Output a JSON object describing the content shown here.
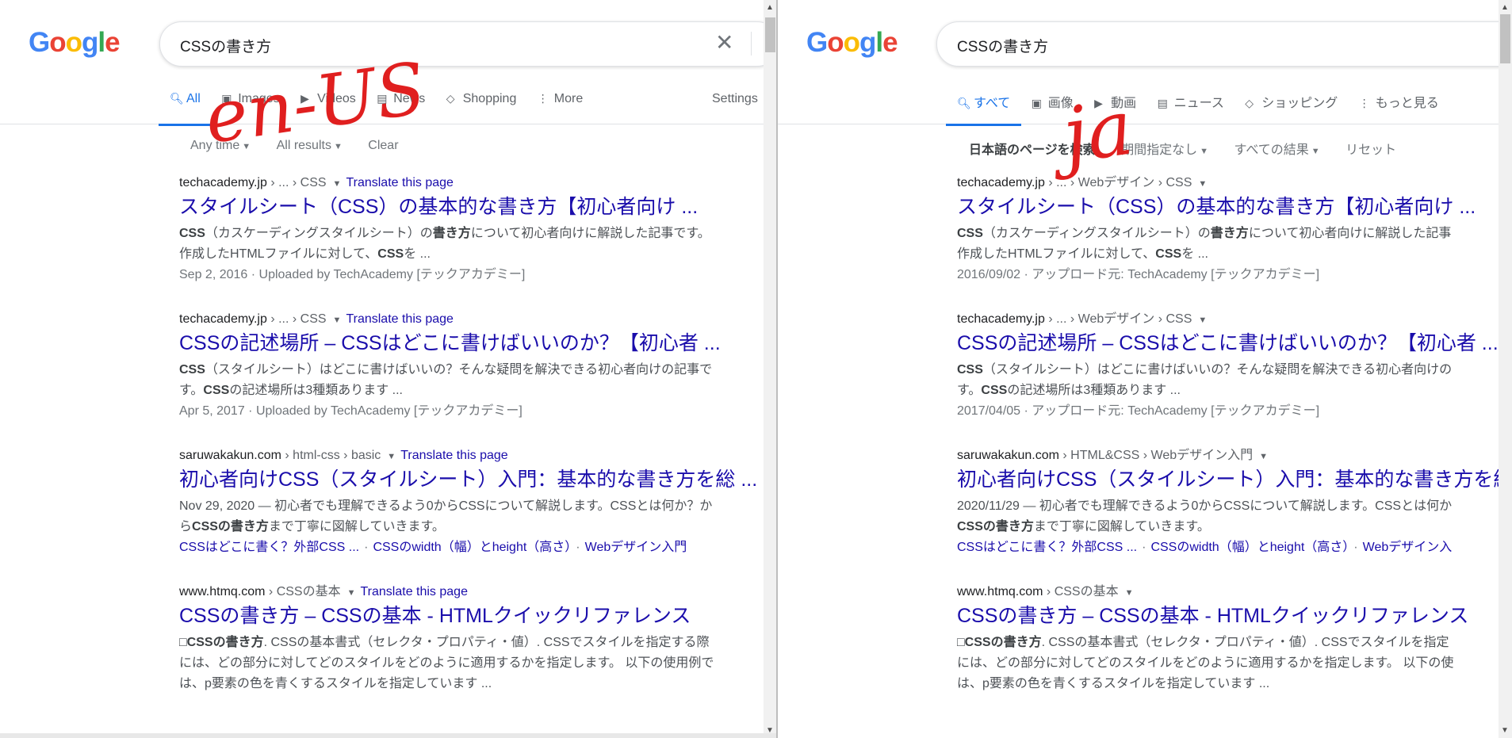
{
  "left": {
    "logo": {
      "g1": "G",
      "o1": "o",
      "o2": "o",
      "g2": "g",
      "l": "l",
      "e": "e"
    },
    "search": {
      "query": "CSSの書き方",
      "clear_icon": "✕"
    },
    "tabs": [
      {
        "label": "All",
        "icon": "search-icon"
      },
      {
        "label": "Images",
        "icon": "image-icon"
      },
      {
        "label": "Videos",
        "icon": "video-icon"
      },
      {
        "label": "News",
        "icon": "news-icon"
      },
      {
        "label": "Shopping",
        "icon": "tag-icon"
      },
      {
        "label": "More",
        "icon": "more-icon"
      }
    ],
    "settings": "Settings",
    "tools": [
      "Any time",
      "All results",
      "Clear"
    ],
    "annotation": "en-US",
    "results": [
      {
        "domain": "techacademy.jp",
        "path": " › ... › CSS",
        "translate": "Translate this page",
        "title": "スタイルシート（CSS）の基本的な書き方【初心者向け ...",
        "s1a": "CSS",
        "s1b": "（カスケーディングスタイルシート）の",
        "s1c": "書き方",
        "s1d": "について初心者向けに解説した記事です。",
        "s2a": "作成したHTMLファイルに対して、",
        "s2b": "CSS",
        "s2c": "を ...",
        "meta": "Sep 2, 2016 · Uploaded by TechAcademy [テックアカデミー]"
      },
      {
        "domain": "techacademy.jp",
        "path": " › ... › CSS",
        "translate": "Translate this page",
        "title": "CSSの記述場所 – CSSはどこに書けばいいのか？【初心者 ...",
        "s1a": "CSS",
        "s1b": "（スタイルシート）はどこに書けばいいの？そんな疑問を解決できる初心者向けの記事で",
        "s2a": "す。",
        "s2b": "CSS",
        "s2c": "の記述場所は3種類あります ...",
        "meta": "Apr 5, 2017 · Uploaded by TechAcademy [テックアカデミー]"
      },
      {
        "domain": "saruwakakun.com",
        "path": " › html-css › basic",
        "translate": "Translate this page",
        "title": "初心者向けCSS（スタイルシート）入門：基本的な書き方を総 ...",
        "s1": "Nov 29, 2020 — 初心者でも理解できるよう0からCSSについて解説します。CSSとは何か？か",
        "s2a": "ら",
        "s2b": "CSSの書き方",
        "s2c": "まで丁寧に図解していきます。",
        "sitelinks": [
          "CSSはどこに書く？外部CSS ...",
          "CSSのwidth（幅）とheight（高さ）",
          "Webデザイン入門"
        ]
      },
      {
        "domain": "www.htmq.com",
        "path": " › CSSの基本",
        "translate": "Translate this page",
        "title": "CSSの書き方 – CSSの基本 - HTMLクイックリファレンス",
        "s1a": "□",
        "s1b": "CSSの書き方",
        "s1c": ". CSSの基本書式（セレクタ・プロパティ・値）. CSSでスタイルを指定する際",
        "s2": "には、どの部分に対してどのスタイルをどのように適用するかを指定します。 以下の使用例で",
        "s3": "は、p要素の色を青くするスタイルを指定しています ..."
      }
    ]
  },
  "right": {
    "logo": {
      "g1": "G",
      "o1": "o",
      "o2": "o",
      "g2": "g",
      "l": "l",
      "e": "e"
    },
    "search": {
      "query": "CSSの書き方"
    },
    "tabs": [
      {
        "label": "すべて",
        "icon": "search-icon"
      },
      {
        "label": "画像",
        "icon": "image-icon"
      },
      {
        "label": "動画",
        "icon": "video-icon"
      },
      {
        "label": "ニュース",
        "icon": "news-icon"
      },
      {
        "label": "ショッピング",
        "icon": "tag-icon"
      },
      {
        "label": "もっと見る",
        "icon": "more-icon"
      }
    ],
    "tools": [
      "日本語のページを検索",
      "期間指定なし",
      "すべての結果",
      "リセット"
    ],
    "annotation": "ja",
    "results": [
      {
        "domain": "techacademy.jp",
        "path": " › ... › Webデザイン › CSS",
        "title": "スタイルシート（CSS）の基本的な書き方【初心者向け ...",
        "s1a": "CSS",
        "s1b": "（カスケーディングスタイルシート）の",
        "s1c": "書き方",
        "s1d": "について初心者向けに解説した記事",
        "s2a": "作成したHTMLファイルに対して、",
        "s2b": "CSS",
        "s2c": "を ...",
        "meta": "2016/09/02 · アップロード元: TechAcademy [テックアカデミー]"
      },
      {
        "domain": "techacademy.jp",
        "path": " › ... › Webデザイン › CSS",
        "title": "CSSの記述場所 – CSSはどこに書けばいいのか？【初心者 ...",
        "s1a": "CSS",
        "s1b": "（スタイルシート）はどこに書けばいいの？そんな疑問を解決できる初心者向けの",
        "s2a": "す。",
        "s2b": "CSS",
        "s2c": "の記述場所は3種類あります ...",
        "meta": "2017/04/05 · アップロード元: TechAcademy [テックアカデミー]"
      },
      {
        "domain": "saruwakakun.com",
        "path": " › HTML&CSS › Webデザイン入門",
        "title": "初心者向けCSS（スタイルシート）入門：基本的な書き方を総",
        "s1": "2020/11/29 — 初心者でも理解できるよう0からCSSについて解説します。CSSとは何か",
        "s2a": "",
        "s2b": "CSSの書き方",
        "s2c": "まで丁寧に図解していきます。",
        "sitelinks": [
          "CSSはどこに書く？外部CSS ...",
          "CSSのwidth（幅）とheight（高さ）",
          "Webデザイン入"
        ]
      },
      {
        "domain": "www.htmq.com",
        "path": " › CSSの基本",
        "title": "CSSの書き方 – CSSの基本 - HTMLクイックリファレンス",
        "s1a": "□",
        "s1b": "CSSの書き方",
        "s1c": ". CSSの基本書式（セレクタ・プロパティ・値）. CSSでスタイルを指定",
        "s2": "には、どの部分に対してどのスタイルをどのように適用するかを指定します。 以下の使",
        "s3": "は、p要素の色を青くするスタイルを指定しています ..."
      }
    ]
  },
  "colors": {
    "link": "#1a0dab",
    "accent": "#1a73e8",
    "annotation": "#e01f1f"
  }
}
